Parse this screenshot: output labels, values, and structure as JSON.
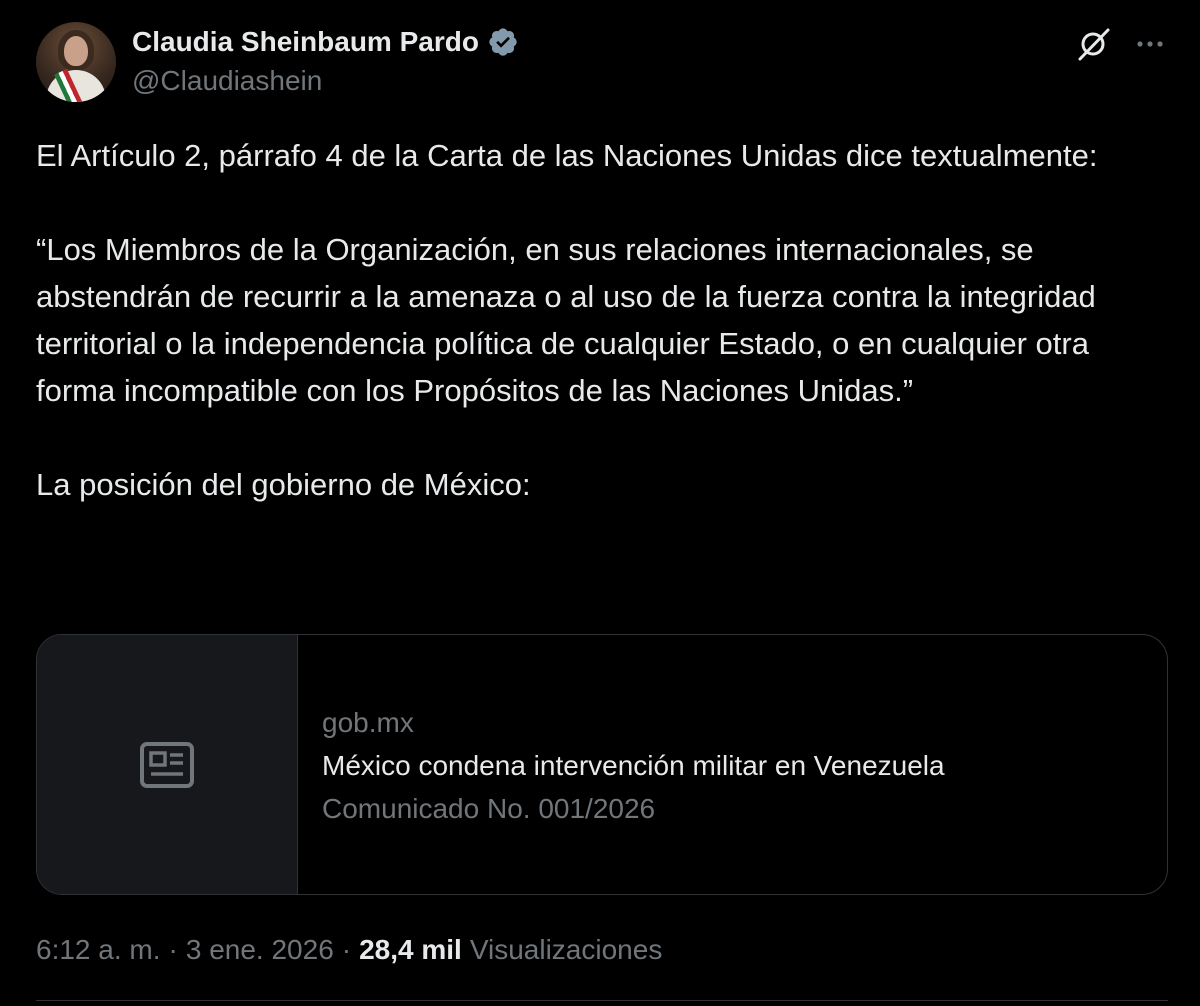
{
  "author": {
    "display_name": "Claudia Sheinbaum Pardo",
    "handle": "@Claudiashein",
    "verified": true,
    "verified_color": "#829aab"
  },
  "post": {
    "paragraphs": [
      "El Artículo 2, párrafo 4 de la Carta de las Naciones Unidas dice textualmente:",
      "“Los Miembros de la Organización, en sus relaciones internacionales, se abstendrán de recurrir a la amenaza o al uso de la fuerza contra la integridad territorial o la independencia política de cualquier Estado, o en cualquier otra forma incompatible con los Propósitos de las Naciones Unidas.”",
      "La posición del gobierno de México:"
    ]
  },
  "link_card": {
    "domain": "gob.mx",
    "title": "México condena intervención militar en Venezuela",
    "description": "Comunicado No. 001/2026",
    "thumbnail_icon": "news-article-icon"
  },
  "meta": {
    "time": "6:12 a. m.",
    "separator": "·",
    "date": "3 ene. 2026",
    "views_count": "28,4 mil",
    "views_label": "Visualizaciones"
  },
  "icons": {
    "grok": "grok-icon",
    "more": "more-options-icon"
  },
  "colors": {
    "background": "#000000",
    "text_primary": "#e7e9ea",
    "text_secondary": "#71767b",
    "border": "#2f3336"
  }
}
